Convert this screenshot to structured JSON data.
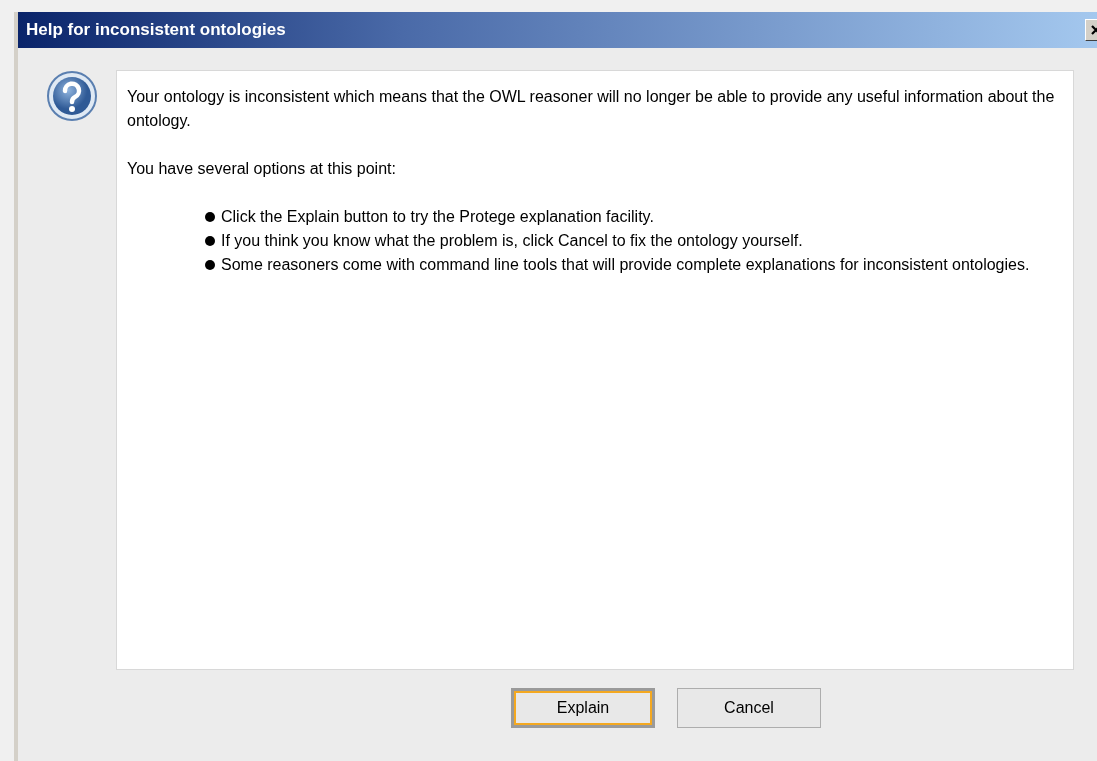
{
  "window": {
    "title": "Help for inconsistent ontologies"
  },
  "message": {
    "paragraphs": [
      "Your ontology is inconsistent which means that the OWL reasoner will no longer be able to provide any useful information about the ontology.",
      "You have several options at this point:"
    ],
    "bullets": [
      "Click the Explain button to try the Protege explanation facility.",
      "If you think you know what the problem is, click Cancel to fix the ontology yourself.",
      "Some reasoners come with command line tools that will provide complete explanations for inconsistent ontologies."
    ]
  },
  "buttons": [
    {
      "label": "Explain",
      "focused": true
    },
    {
      "label": "Cancel",
      "focused": false
    }
  ]
}
